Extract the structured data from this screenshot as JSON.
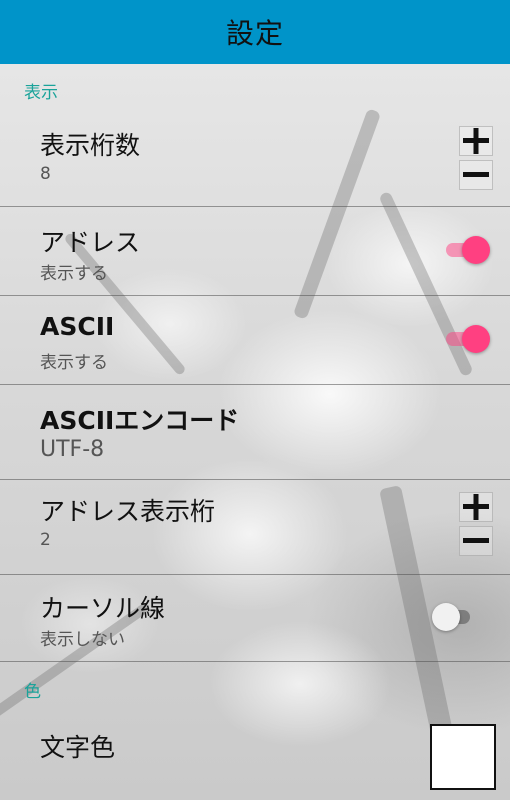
{
  "appbar": {
    "title": "設定"
  },
  "sections": {
    "display": {
      "header": "表示"
    },
    "color": {
      "header": "色"
    }
  },
  "items": {
    "digits": {
      "title": "表示桁数",
      "value": "8"
    },
    "address": {
      "title": "アドレス",
      "summary": "表示する",
      "enabled": true
    },
    "ascii": {
      "title": "ASCII",
      "summary": "表示する",
      "enabled": true
    },
    "ascii_encoding": {
      "title": "ASCIIエンコード",
      "value": "UTF-8"
    },
    "address_digits": {
      "title": "アドレス表示桁",
      "value": "2"
    },
    "cursor_line": {
      "title": "カーソル線",
      "summary": "表示しない",
      "enabled": false
    },
    "text_color": {
      "title": "文字色",
      "color": "#ffffff"
    }
  },
  "colors": {
    "appbar": "#0094c9",
    "accent": "#ff4081",
    "section_header": "#1aa39a"
  },
  "icons": {
    "increment": "plus-icon",
    "decrement": "minus-icon"
  }
}
